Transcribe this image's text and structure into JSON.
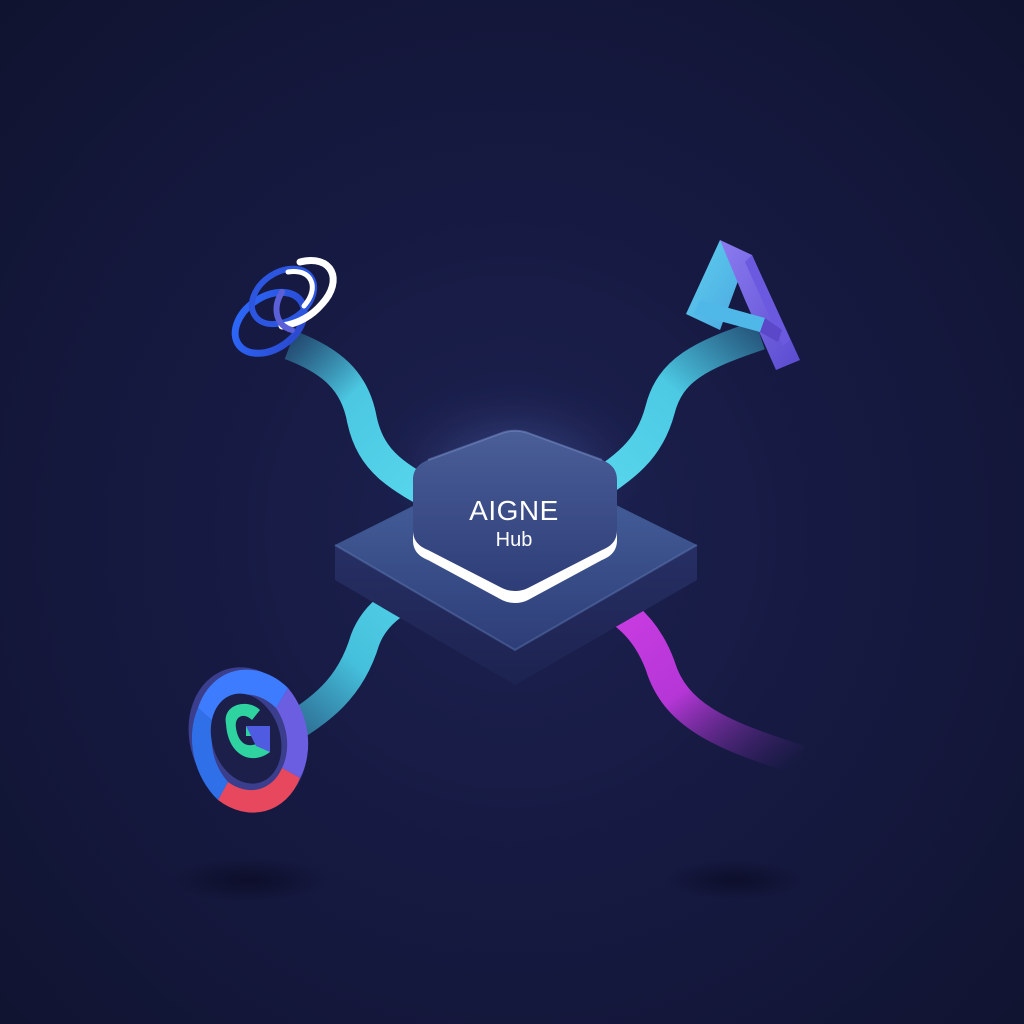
{
  "hub": {
    "title": "AIGNE",
    "subtitle": "Hub"
  },
  "nodes": [
    {
      "icon": "orbit-rings-icon",
      "position": "top-left"
    },
    {
      "icon": "stacked-a-icon",
      "position": "top-right"
    },
    {
      "icon": "g-circle-icon",
      "position": "bottom-left"
    },
    {
      "icon": "none",
      "position": "bottom-right"
    }
  ],
  "colors": {
    "background": "#14173d",
    "connector_cyan": "#4fd6ea",
    "connector_magenta": "#c93be0",
    "hub_face": "#3a4a86",
    "hub_edge": "#ffffff"
  }
}
